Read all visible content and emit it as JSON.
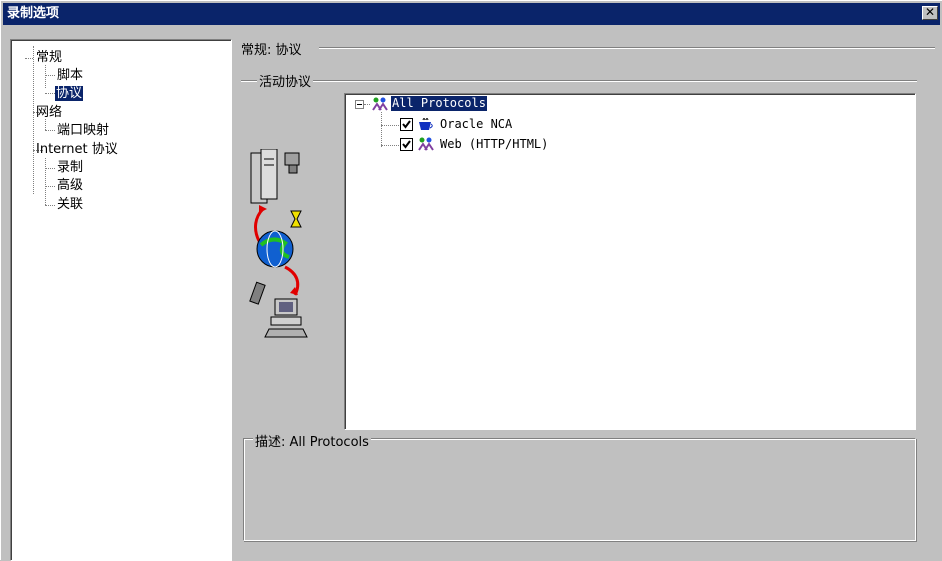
{
  "window": {
    "title": "录制选项",
    "close_glyph": "✕"
  },
  "nav_tree": {
    "items": [
      {
        "label": "常规"
      },
      {
        "label": "脚本"
      },
      {
        "label": "协议"
      },
      {
        "label": "网络"
      },
      {
        "label": "端口映射"
      },
      {
        "label": "Internet 协议"
      },
      {
        "label": "录制"
      },
      {
        "label": "高级"
      },
      {
        "label": "关联"
      }
    ],
    "selected": "协议"
  },
  "panel": {
    "header": "常规: 协议",
    "active_protocols_label": "活动协议",
    "protocols": {
      "root_label": "All Protocols",
      "children": [
        {
          "label": "Oracle NCA",
          "checked": true,
          "icon": "oracle-cup-icon"
        },
        {
          "label": "Web (HTTP/HTML)",
          "checked": true,
          "icon": "web-protocol-icon"
        }
      ]
    },
    "description_label": "描述: All Protocols"
  },
  "colors": {
    "title_bar": "#0a246a",
    "selection": "#0a246a",
    "face": "#c0c0c0"
  }
}
